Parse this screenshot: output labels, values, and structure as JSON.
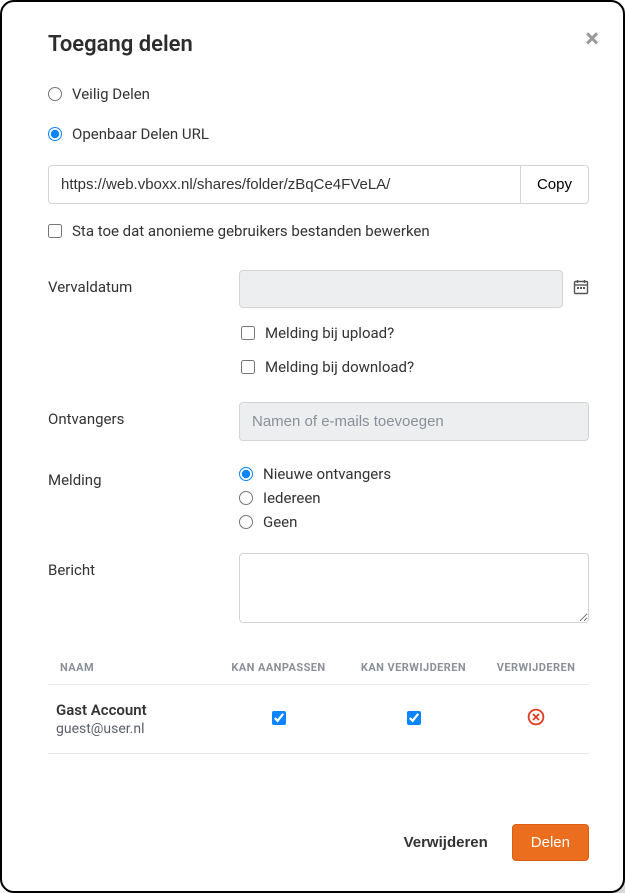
{
  "modal": {
    "title": "Toegang delen",
    "close_icon": "close-icon"
  },
  "share_mode": {
    "secure_label": "Veilig Delen",
    "public_label": "Openbaar Delen URL",
    "selected": "public"
  },
  "url_row": {
    "value": "https://web.vboxx.nl/shares/folder/zBqCe4FVeLA/",
    "copy_label": "Copy"
  },
  "anon_edit": {
    "label": "Sta toe dat anonieme gebruikers bestanden bewerken",
    "checked": false
  },
  "fields": {
    "expiry_label": "Vervaldatum",
    "expiry_value": "",
    "notify_upload_label": "Melding bij upload?",
    "notify_upload_checked": false,
    "notify_download_label": "Melding bij download?",
    "notify_download_checked": false,
    "recipients_label": "Ontvangers",
    "recipients_placeholder": "Namen of e-mails toevoegen",
    "notification_label": "Melding",
    "notify_opts": {
      "new": "Nieuwe ontvangers",
      "all": "Iedereen",
      "none": "Geen",
      "selected": "new"
    },
    "message_label": "Bericht",
    "message_value": ""
  },
  "table": {
    "headers": {
      "name": "NAAM",
      "can_edit": "KAN AANPASSEN",
      "can_delete": "KAN VERWIJDEREN",
      "remove": "VERWIJDEREN"
    },
    "rows": [
      {
        "name": "Gast Account",
        "email": "guest@user.nl",
        "can_edit": true,
        "can_delete": true
      }
    ]
  },
  "footer": {
    "delete_label": "Verwijderen",
    "share_label": "Delen"
  }
}
